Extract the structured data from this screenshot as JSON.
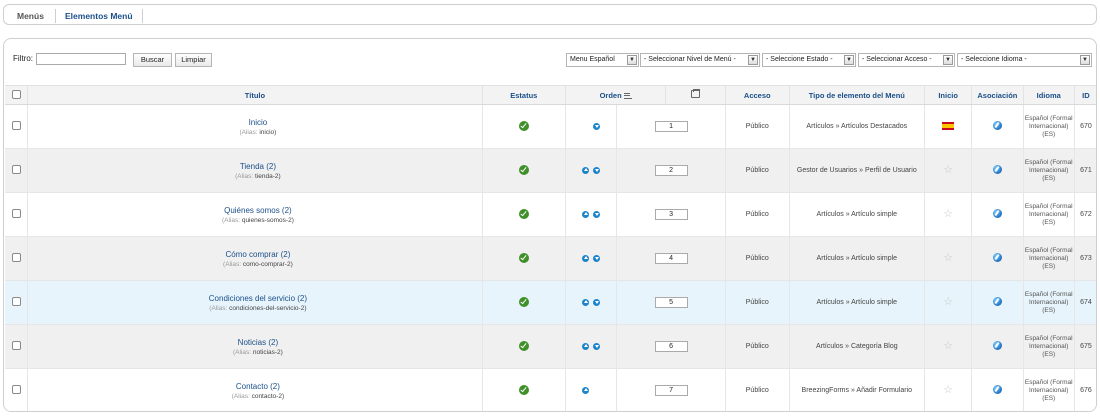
{
  "submenu": {
    "tabs": [
      {
        "label": "Menús"
      },
      {
        "label": "Elementos Menú"
      }
    ]
  },
  "filter": {
    "label": "Filtro:",
    "value": "",
    "search_label": "Buscar",
    "clear_label": "Limpiar",
    "selects": [
      {
        "value": "Menu Español"
      },
      {
        "value": "- Seleccionar Nivel de Menú -"
      },
      {
        "value": "- Seleccione Estado -"
      },
      {
        "value": "- Seleccionar Acceso -"
      },
      {
        "value": "- Seleccione Idioma -"
      }
    ]
  },
  "table": {
    "headers": {
      "title": "Título",
      "status": "Estatus",
      "order": "Orden",
      "access": "Acceso",
      "type": "Tipo de elemento del Menú",
      "home": "Inicio",
      "association": "Asociación",
      "language": "Idioma",
      "id": "ID"
    },
    "alias_label": "(Alias:",
    "rows": [
      {
        "title": "Inicio",
        "alias": "inicio",
        "order": "1",
        "access": "Público",
        "type": "Artículos » Artículos Destacados",
        "home": "flag-es",
        "language": "Español (Formal Internacional) (ES)",
        "id": "670",
        "arrows": [
          "none",
          "down"
        ]
      },
      {
        "title": "Tienda (2)",
        "alias": "tienda-2",
        "order": "2",
        "access": "Público",
        "type": "Gestor de Usuarios » Perfil de Usuario",
        "home": "star",
        "language": "Español (Formal Internacional) (ES)",
        "id": "671",
        "arrows": [
          "up",
          "down"
        ]
      },
      {
        "title": "Quiénes somos (2)",
        "alias": "quienes-somos-2",
        "order": "3",
        "access": "Público",
        "type": "Artículos » Artículo simple",
        "home": "star",
        "language": "Español (Formal Internacional) (ES)",
        "id": "672",
        "arrows": [
          "up",
          "down"
        ]
      },
      {
        "title": "Cómo comprar (2)",
        "alias": "como-comprar-2",
        "order": "4",
        "access": "Público",
        "type": "Artículos » Artículo simple",
        "home": "star",
        "language": "Español (Formal Internacional) (ES)",
        "id": "673",
        "arrows": [
          "up",
          "down"
        ]
      },
      {
        "title": "Condiciones del servicio (2)",
        "alias": "condiciones-del-servicio-2",
        "order": "5",
        "access": "Público",
        "type": "Artículos » Artículo simple",
        "home": "star",
        "language": "Español (Formal Internacional) (ES)",
        "id": "674",
        "arrows": [
          "up",
          "down"
        ]
      },
      {
        "title": "Noticias (2)",
        "alias": "noticias-2",
        "order": "6",
        "access": "Público",
        "type": "Artículos » Categoría Blog",
        "home": "star",
        "language": "Español (Formal Internacional) (ES)",
        "id": "675",
        "arrows": [
          "up",
          "down"
        ]
      },
      {
        "title": "Contacto (2)",
        "alias": "contacto-2",
        "order": "7",
        "access": "Público",
        "type": "BreezingForms » Añadir Formulario",
        "home": "star",
        "language": "Español (Formal Internacional) (ES)",
        "id": "676",
        "arrows": [
          "up",
          "none"
        ]
      }
    ]
  },
  "colors": {
    "link": "#1b4f8a",
    "status_green": "#3f8f2a",
    "order_blue": "#1d84c9",
    "hover_row": "#e7f4fb"
  }
}
